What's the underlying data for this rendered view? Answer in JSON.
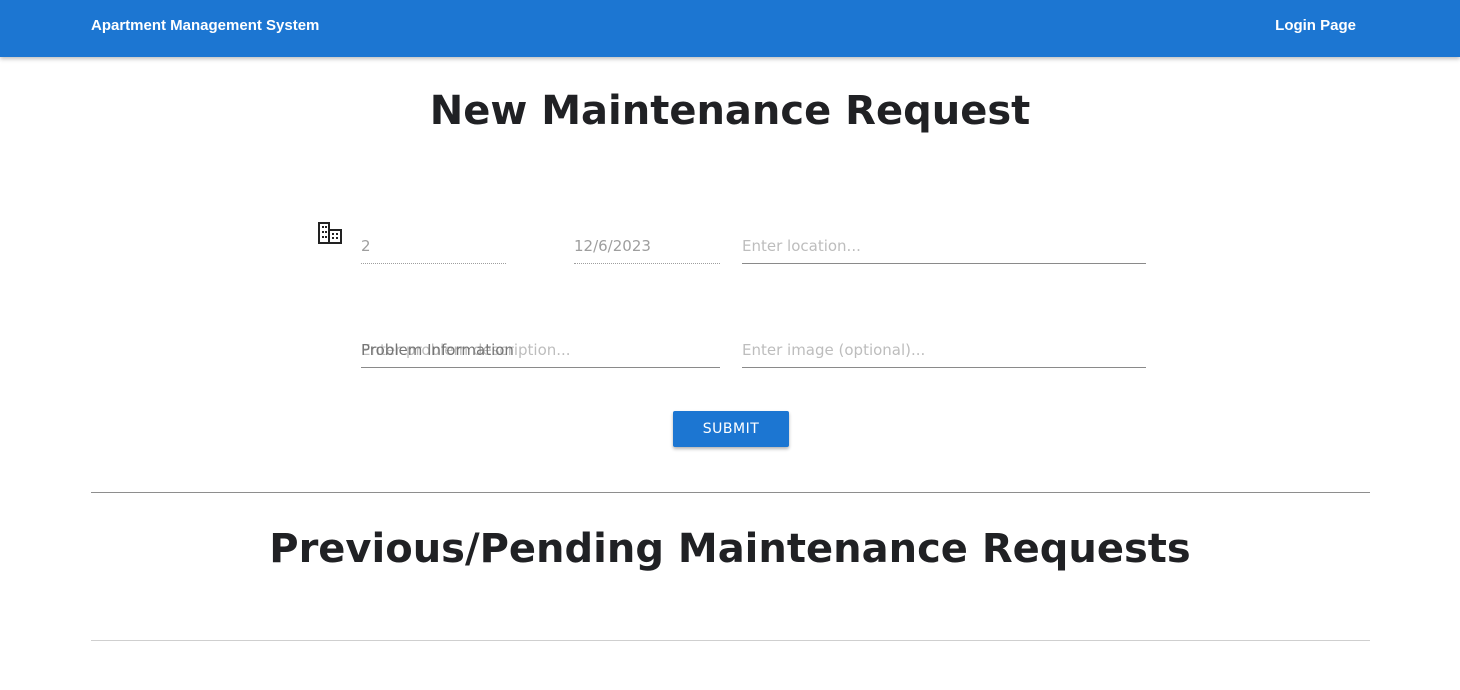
{
  "header": {
    "brand": "Apartment Management System",
    "login_link": "Login Page",
    "accent_color": "#1c76d2"
  },
  "new_request": {
    "title": "New Maintenance Request",
    "unit_icon": "building-icon",
    "unit_value": "2",
    "date_value": "12/6/2023",
    "location_placeholder": "Enter location...",
    "problem_label": "Problem Information",
    "problem_placeholder": "Enter problem description...",
    "image_placeholder": "Enter image (optional)...",
    "submit_label": "SUBMIT"
  },
  "previous_requests": {
    "title": "Previous/Pending Maintenance Requests"
  }
}
